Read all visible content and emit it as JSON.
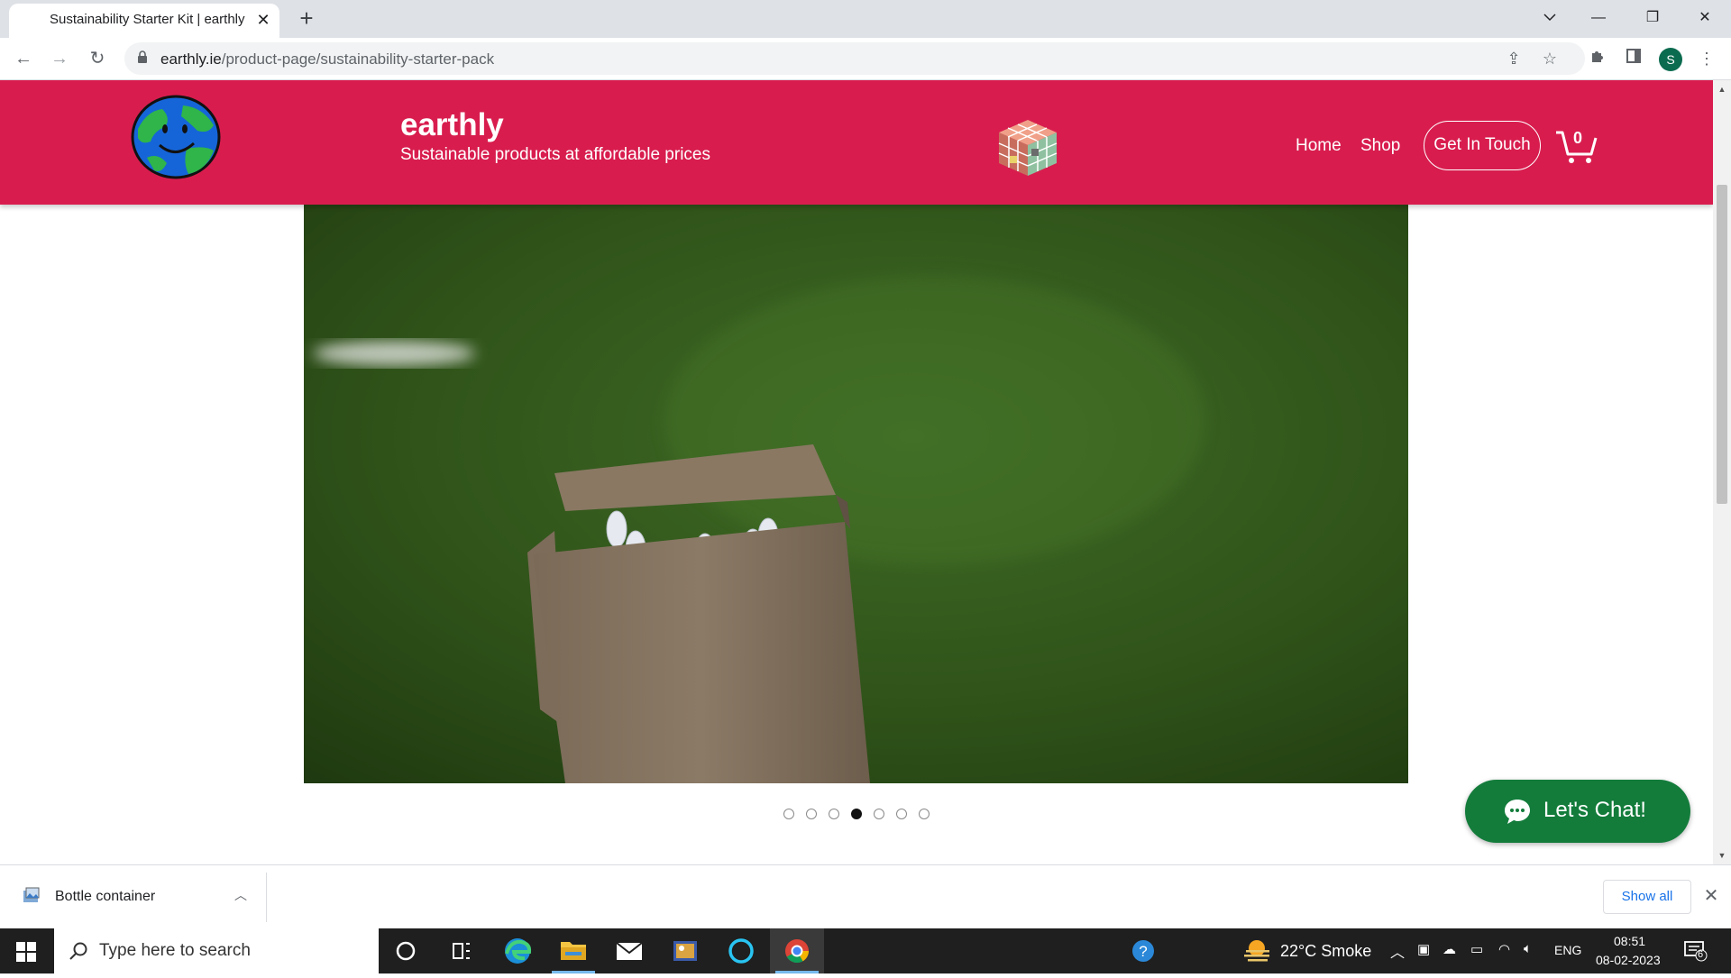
{
  "browser": {
    "tab_title": "Sustainability Starter Kit | earthly",
    "url_host": "earthly.ie",
    "url_path": "/product-page/sustainability-starter-pack",
    "profile_initial": "S"
  },
  "site": {
    "brand_name": "earthly",
    "tagline": "Sustainable products at affordable prices",
    "nav": {
      "home": "Home",
      "shop": "Shop",
      "contact": "Get In Touch"
    },
    "cart_count": "0",
    "colors": {
      "header": "#d81d4e",
      "chat": "#137c3b"
    }
  },
  "gallery": {
    "slide_count": 7,
    "active_index": 3
  },
  "chat": {
    "label": "Let's Chat!"
  },
  "downloads": {
    "file_name": "Bottle container",
    "show_all": "Show all"
  },
  "taskbar": {
    "search_placeholder": "Type here to search",
    "weather": "22°C  Smoke",
    "language": "ENG",
    "time": "08:51",
    "date": "08-02-2023",
    "notification_count": "6"
  }
}
